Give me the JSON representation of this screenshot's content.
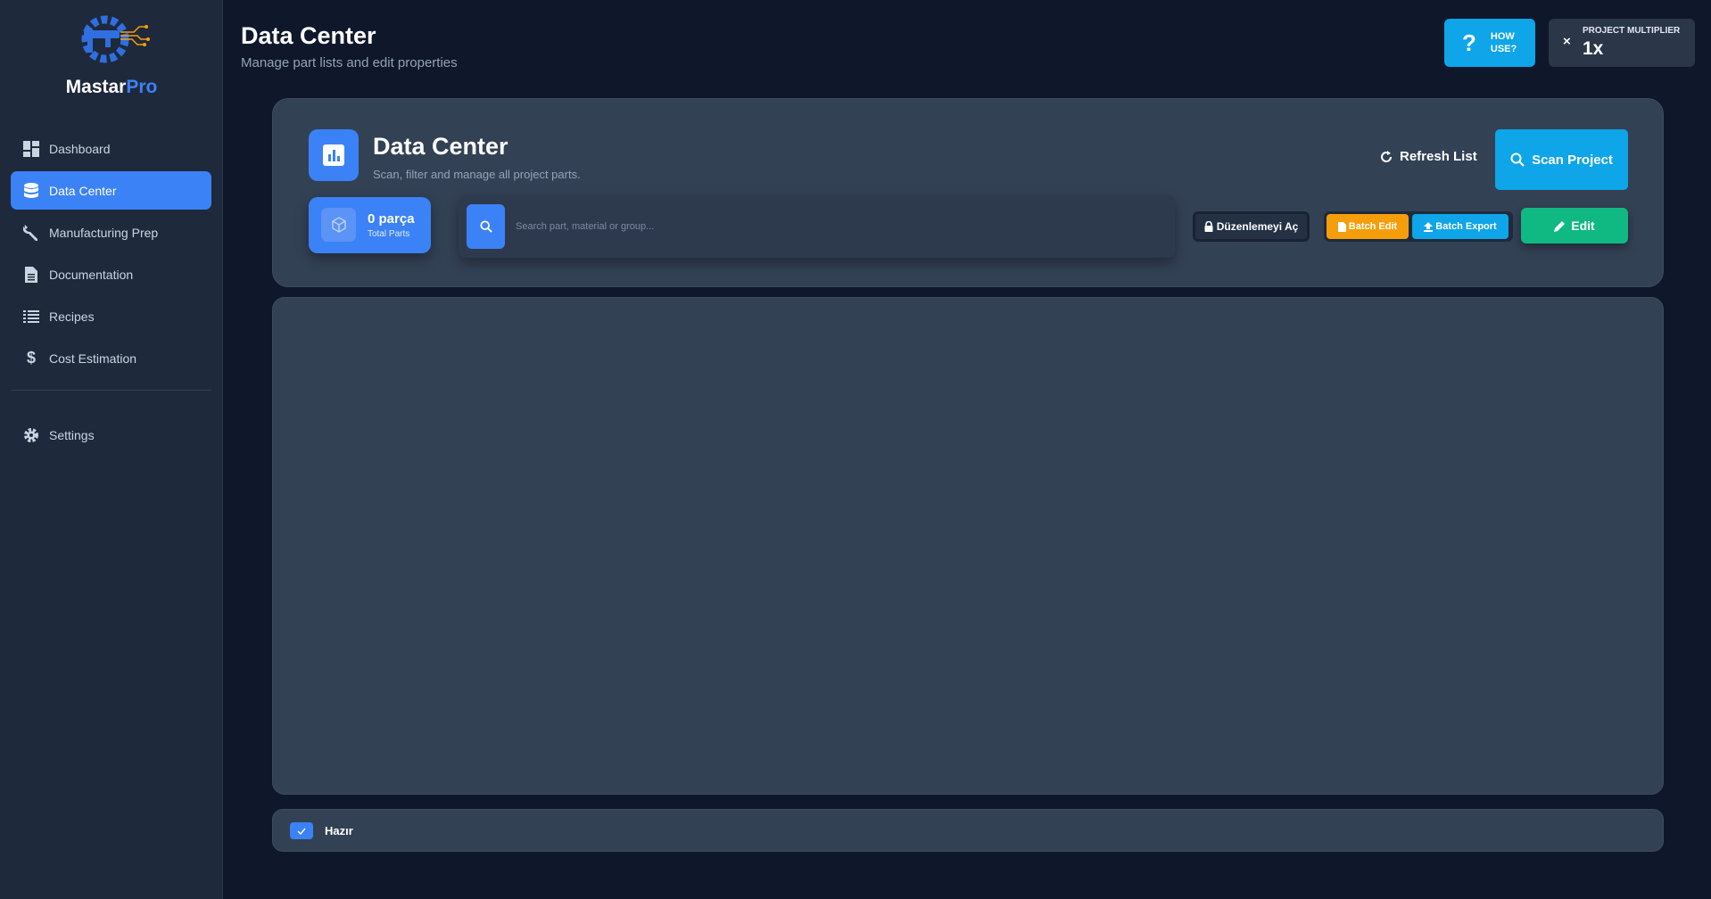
{
  "brand": {
    "name": "Mastar",
    "name_accent": "Pro"
  },
  "sidebar": {
    "items": [
      {
        "label": "Dashboard",
        "icon": "dashboard-icon",
        "active": false
      },
      {
        "label": "Data Center",
        "icon": "database-icon",
        "active": true
      },
      {
        "label": "Manufacturing Prep",
        "icon": "wrench-icon",
        "active": false
      },
      {
        "label": "Documentation",
        "icon": "document-icon",
        "active": false
      },
      {
        "label": "Recipes",
        "icon": "list-icon",
        "active": false
      },
      {
        "label": "Cost Estimation",
        "icon": "dollar-icon",
        "active": false
      }
    ],
    "settings": {
      "label": "Settings",
      "icon": "gear-icon"
    }
  },
  "header": {
    "title": "Data Center",
    "subtitle": "Manage part lists and edit properties",
    "how_to": {
      "icon_text": "?",
      "line1": "HOW",
      "line2": "USE?"
    },
    "multiplier": {
      "symbol": "×",
      "label": "PROJECT MULTIPLIER",
      "value": "1x"
    }
  },
  "panel": {
    "title": "Data Center",
    "subtitle": "Scan, filter and manage all project parts.",
    "refresh_label": "Refresh List",
    "scan_label": "Scan Project",
    "count": {
      "value": "0 parça",
      "label": "Total Parts"
    },
    "search": {
      "placeholder": "Search part, material or group...",
      "value": ""
    },
    "lock_label": "Düzenlemeyi Aç",
    "batch_edit_label": "Batch Edit",
    "batch_export_label": "Batch Export",
    "edit_label": "Edit"
  },
  "status": {
    "text": "Hazır",
    "checked": true
  },
  "colors": {
    "background": "#0f172a",
    "sidebar": "#1e293b",
    "card": "#334155",
    "primary": "#3b82f6",
    "info": "#0ea5e9",
    "warning": "#f59e0b",
    "success": "#10b981"
  }
}
